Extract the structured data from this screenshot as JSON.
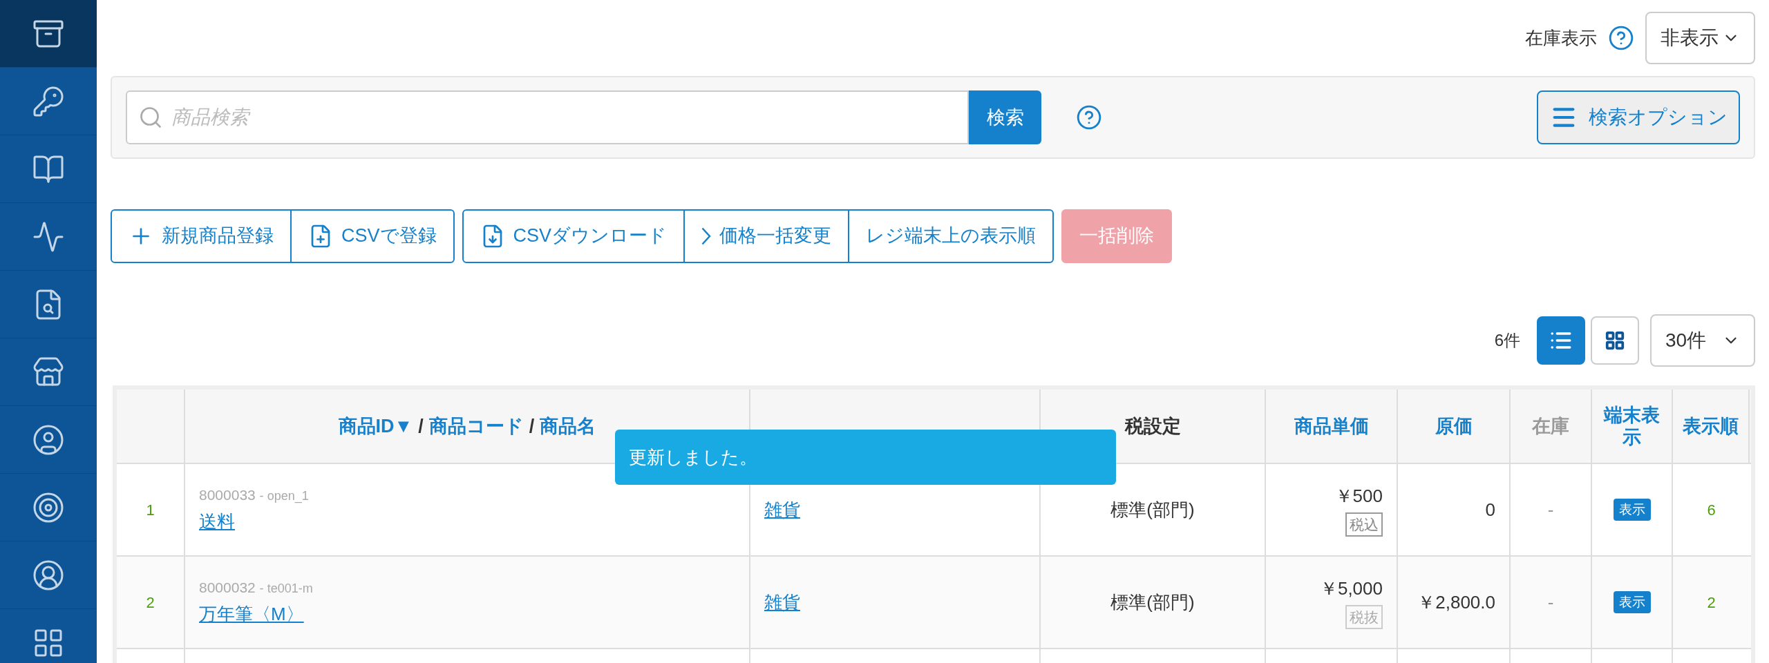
{
  "sidebar": {
    "items": [
      {
        "kind": "box",
        "selected": true
      },
      {
        "kind": "key",
        "selected": false
      },
      {
        "kind": "book",
        "selected": false
      },
      {
        "kind": "zigzag",
        "selected": false
      },
      {
        "kind": "sheet-search",
        "selected": false
      },
      {
        "kind": "store",
        "selected": false
      },
      {
        "kind": "user-circle",
        "selected": false
      },
      {
        "kind": "target",
        "selected": false
      },
      {
        "kind": "person-circle",
        "selected": false
      },
      {
        "kind": "grid",
        "selected": false
      }
    ]
  },
  "stock_display": {
    "label": "在庫表示",
    "value": "非表示"
  },
  "search": {
    "placeholder": "商品検索",
    "button": "検索",
    "options_button": "検索オプション"
  },
  "actions": [
    {
      "label": "新規商品登録",
      "kind": "add",
      "disabled": false
    },
    {
      "label": "CSVで登録",
      "kind": "csv-import",
      "disabled": false
    },
    {
      "label": "CSVダウンロード",
      "kind": "csv-download",
      "disabled": false
    },
    {
      "label": "価格一括変更",
      "kind": "bulk-price",
      "disabled": false
    },
    {
      "label": "レジ端末上の表示順",
      "kind": "display-order",
      "disabled": false
    },
    {
      "label": "一括削除",
      "kind": "bulk-delete",
      "disabled": true
    }
  ],
  "count": "6件",
  "view_modes": [
    {
      "kind": "list",
      "selected": true
    },
    {
      "kind": "grid",
      "selected": false
    }
  ],
  "per_page": "30件",
  "table": {
    "columns": [
      {
        "parts": [
          {
            "text": "商品ID▼",
            "kind": "link"
          },
          {
            "text": "/",
            "kind": "sep"
          },
          {
            "text": "商品コード",
            "kind": "link"
          },
          {
            "text": "/",
            "kind": "sep"
          },
          {
            "text": "商品名",
            "kind": "link"
          }
        ]
      },
      {
        "parts": [
          {
            "text": "税設定",
            "kind": "plain"
          }
        ]
      },
      {
        "parts": [
          {
            "text": "商品単価",
            "kind": "link"
          }
        ]
      },
      {
        "parts": [
          {
            "text": "原価",
            "kind": "link"
          }
        ]
      },
      {
        "parts": [
          {
            "text": "在庫",
            "kind": "muted"
          }
        ]
      },
      {
        "parts": [
          {
            "text": "端末表示",
            "kind": "link"
          }
        ]
      },
      {
        "parts": [
          {
            "text": "表示順",
            "kind": "link"
          }
        ]
      }
    ],
    "rows": [
      {
        "index": "1",
        "id": "8000033",
        "separator": "-",
        "code": "open_1",
        "name": "送料",
        "department": "雑貨",
        "tax": "標準(部門)",
        "price": "￥500",
        "tax_badge": {
          "label": "税込",
          "kind": "included"
        },
        "cost": "0",
        "stock": "-",
        "terminal": "表示",
        "order": "6"
      },
      {
        "index": "2",
        "id": "8000032",
        "separator": "-",
        "code": "te001-m",
        "name": "万年筆〈M〉",
        "department": "雑貨",
        "tax": "標準(部門)",
        "price": "￥5,000",
        "tax_badge": {
          "label": "税抜",
          "kind": "excluded"
        },
        "cost": "￥2,800.0",
        "stock": "-",
        "terminal": "表示",
        "order": "2"
      }
    ]
  },
  "toast": {
    "message": "更新しました。"
  }
}
